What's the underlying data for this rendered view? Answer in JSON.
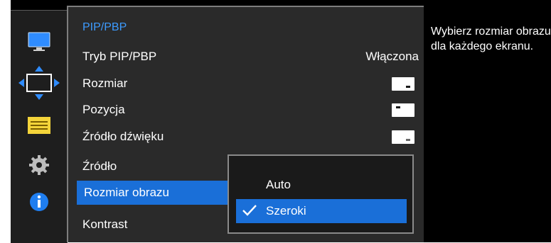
{
  "colors": {
    "accent": "#1a6fd8",
    "title": "#3d9bff",
    "panel_bg": "#2a2a2a",
    "osd_bg": "#000000"
  },
  "sidebar": {
    "icons": [
      "monitor-icon",
      "screen-adjust-icon",
      "settings-list-icon",
      "gear-icon",
      "info-icon"
    ],
    "active_index": 1
  },
  "panel": {
    "title": "PIP/PBP",
    "items": [
      {
        "label": "Tryb PIP/PBP",
        "value": "Włączona"
      },
      {
        "label": "Rozmiar",
        "icon": "size-preview-icon"
      },
      {
        "label": "Pozycja",
        "icon": "position-preview-icon"
      },
      {
        "label": "Źródło dźwięku",
        "icon": "sound-source-preview-icon"
      },
      {
        "label": "Źródło"
      },
      {
        "label": "Rozmiar obrazu",
        "selected": true
      },
      {
        "label": "Kontrast"
      }
    ]
  },
  "dropdown": {
    "options": [
      {
        "label": "Auto",
        "selected": false
      },
      {
        "label": "Szeroki",
        "selected": true
      }
    ]
  },
  "help": {
    "text": "Wybierz rozmiar obrazu dla każdego ekranu."
  }
}
